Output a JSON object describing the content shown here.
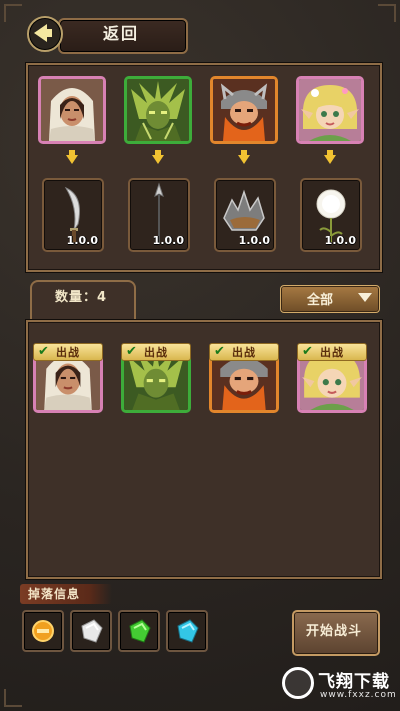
{
  "header": {
    "back_label": "返回"
  },
  "colors": {
    "gold": "#f1c232",
    "frame": "#8f6d47",
    "panel": "#3e3028",
    "pink_border": "#d781b4",
    "green_border": "#3dac3a",
    "orange_border": "#e2862c"
  },
  "heroes": [
    {
      "name": "hooded-woman",
      "rarity_color": "#d781b4",
      "equipment": {
        "icon": "scimitar-icon",
        "level": "1.0.0"
      }
    },
    {
      "name": "green-warrior",
      "rarity_color": "#3dac3a",
      "equipment": {
        "icon": "spear-icon",
        "level": "1.0.0"
      }
    },
    {
      "name": "orange-dwarf",
      "rarity_color": "#e2862c",
      "equipment": {
        "icon": "spiked-gauntlet-icon",
        "level": "1.0.0"
      }
    },
    {
      "name": "blonde-elf",
      "rarity_color": "#d781b4",
      "equipment": {
        "icon": "dandelion-icon",
        "level": "1.0.0"
      }
    }
  ],
  "roster": {
    "count_label": "数量：4",
    "filter_label": "全部",
    "team": [
      {
        "name": "hooded-woman",
        "badge": "出战"
      },
      {
        "name": "green-warrior",
        "badge": "出战"
      },
      {
        "name": "orange-dwarf",
        "badge": "出战"
      },
      {
        "name": "blonde-elf",
        "badge": "出战"
      }
    ]
  },
  "drops": {
    "label": "掉落信息",
    "items": [
      {
        "icon": "gold-coin-icon",
        "color": "#f0a020"
      },
      {
        "icon": "white-gem-icon",
        "color": "#e8e8e8"
      },
      {
        "icon": "green-gem-icon",
        "color": "#44cc33"
      },
      {
        "icon": "blue-gem-icon",
        "color": "#33c6e6"
      }
    ]
  },
  "actions": {
    "start_battle_label": "开始战斗"
  },
  "watermark": {
    "brand": "飞翔下载",
    "url": "www.fxxz.com"
  }
}
